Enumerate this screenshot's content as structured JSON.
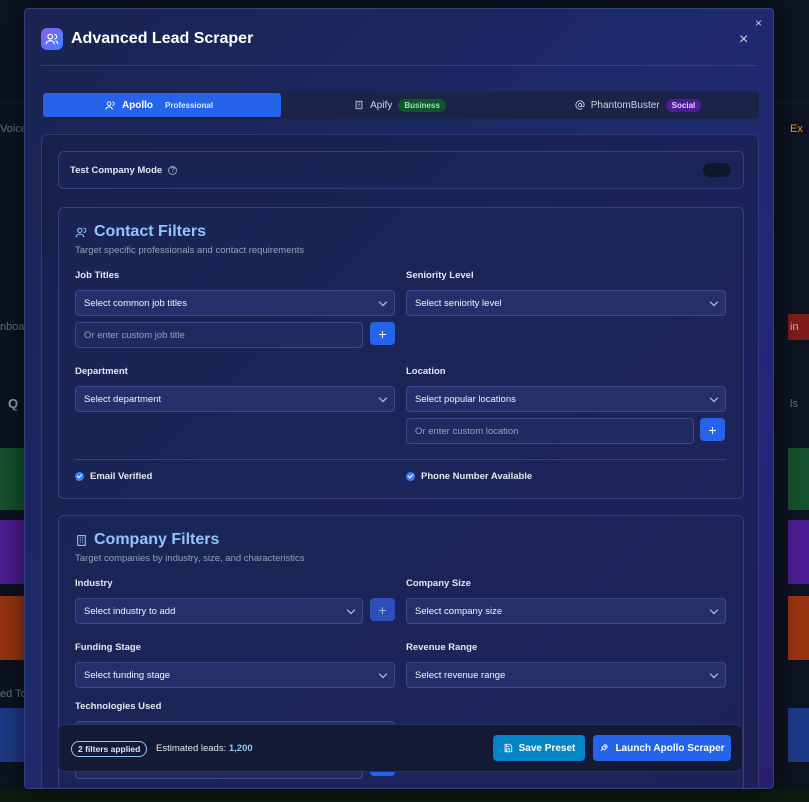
{
  "background": {
    "left_snippets": [
      "Voice",
      "nboa",
      "Q",
      "ed To"
    ],
    "right_snippets": [
      "Ex",
      "in",
      "ls"
    ]
  },
  "modal": {
    "title": "Advanced Lead Scraper",
    "close_symbol": "×"
  },
  "tabs": [
    {
      "label": "Apollo",
      "badge": "Professional",
      "icon": "users-icon",
      "active": true
    },
    {
      "label": "Apify",
      "badge": "Business",
      "icon": "building-icon",
      "active": false
    },
    {
      "label": "PhantomBuster",
      "badge": "Social",
      "icon": "at-icon",
      "active": false
    }
  ],
  "test_mode": {
    "label": "Test Company Mode",
    "help": "?"
  },
  "contact_filters": {
    "title": "Contact Filters",
    "subtitle": "Target specific professionals and contact requirements",
    "job_titles_label": "Job Titles",
    "job_titles_select": "Select common job titles",
    "job_titles_custom_placeholder": "Or enter custom job title",
    "seniority_label": "Seniority Level",
    "seniority_select": "Select seniority level",
    "department_label": "Department",
    "department_select": "Select department",
    "location_label": "Location",
    "location_select": "Select popular locations",
    "location_custom_placeholder": "Or enter custom location",
    "email_verified": "Email Verified",
    "phone_available": "Phone Number Available"
  },
  "company_filters": {
    "title": "Company Filters",
    "subtitle": "Target companies by industry, size, and characteristics",
    "industry_label": "Industry",
    "industry_select": "Select industry to add",
    "company_size_label": "Company Size",
    "company_size_select": "Select company size",
    "funding_label": "Funding Stage",
    "funding_select": "Select funding stage",
    "revenue_label": "Revenue Range",
    "revenue_select": "Select revenue range",
    "tech_label": "Technologies Used"
  },
  "footer": {
    "filters_applied": "2 filters applied",
    "estimated_label": "Estimated leads:",
    "estimated_value": "1,200",
    "save_label": "Save Preset",
    "launch_label": "Launch Apollo Scraper"
  },
  "plus_symbol": "+"
}
